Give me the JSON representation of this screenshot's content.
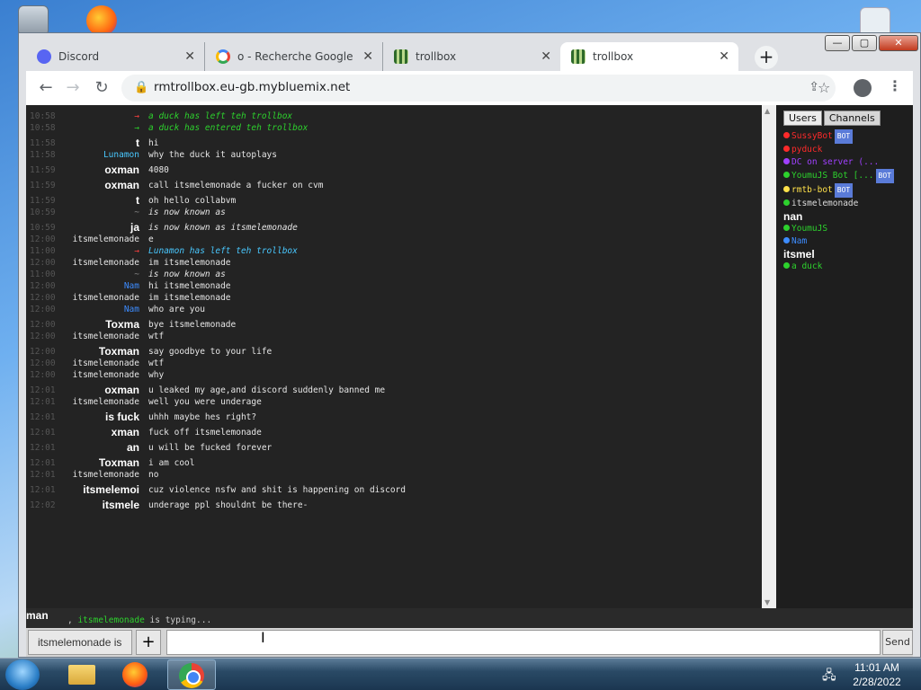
{
  "browser": {
    "tabs": [
      {
        "label": "Discord",
        "icon": "discord-icon"
      },
      {
        "label": "o - Recherche Google",
        "icon": "google-icon"
      },
      {
        "label": "trollbox",
        "icon": "trollbox-icon"
      },
      {
        "label": "trollbox",
        "icon": "trollbox-icon",
        "active": true
      }
    ],
    "new_tab": "+",
    "url": "rmtrollbox.eu-gb.mybluemix.net",
    "win_min": "—",
    "win_max": "▢",
    "win_close": "✕"
  },
  "chat": {
    "messages": [
      {
        "time": "10:58",
        "name": "→",
        "text": "a duck has left teh trollbox",
        "sys": true,
        "color": "#ff4040",
        "tcolor": "#2dd12d"
      },
      {
        "time": "10:58",
        "name": "→",
        "text": "a duck has entered teh trollbox",
        "sys": true,
        "color": "#2dd12d",
        "tcolor": "#2dd12d"
      },
      {
        "time": "11:58",
        "name": "t",
        "text": "hi",
        "big": true
      },
      {
        "time": "11:58",
        "name": "Lunamon",
        "text": "why the duck it autoplays",
        "color": "#49c8ff"
      },
      {
        "time": "11:59",
        "name": "oxman",
        "text": "4080",
        "big": true
      },
      {
        "time": "11:59",
        "name": "oxman",
        "text": "call itsmelemonade a fucker on cvm",
        "big": true
      },
      {
        "time": "11:59",
        "name": "t",
        "text": "oh hello collabvm",
        "big": true
      },
      {
        "time": "10:59",
        "name": "~",
        "text": "is now known as",
        "sys": true,
        "color": "#888"
      },
      {
        "time": "10:59",
        "name": "ja",
        "text": "is now known as itsmelemonade",
        "sys": true,
        "color": "#fff",
        "big": true
      },
      {
        "time": "12:00",
        "name": "itsmelemonade",
        "text": "e"
      },
      {
        "time": "11:00",
        "name": "→",
        "text": "Lunamon has left teh trollbox",
        "sys": true,
        "color": "#ff4040",
        "tcolor": "#49c8ff"
      },
      {
        "time": "12:00",
        "name": "itsmelemonade",
        "text": "im itsmelemonade"
      },
      {
        "time": "11:00",
        "name": "~",
        "text": "is now known as",
        "sys": true,
        "color": "#888"
      },
      {
        "time": "12:00",
        "name": "Nam",
        "text": "hi itsmelemonade",
        "color": "#3d8cff"
      },
      {
        "time": "12:00",
        "name": "itsmelemonade",
        "text": "im itsmelemonade"
      },
      {
        "time": "12:00",
        "name": "Nam",
        "text": "who are you",
        "color": "#3d8cff"
      },
      {
        "time": "12:00",
        "name": "Toxma",
        "text": "bye itsmelemonade",
        "big": true
      },
      {
        "time": "12:00",
        "name": "itsmelemonade",
        "text": "wtf"
      },
      {
        "time": "12:00",
        "name": "Toxman",
        "text": "say goodbye to your life",
        "big": true
      },
      {
        "time": "12:00",
        "name": "itsmelemonade",
        "text": "wtf"
      },
      {
        "time": "12:00",
        "name": "itsmelemonade",
        "text": "why"
      },
      {
        "time": "12:01",
        "name": "oxman",
        "text": "u leaked my age,and discord suddenly banned me",
        "big": true
      },
      {
        "time": "12:01",
        "name": "itsmelemonade",
        "text": "well you were underage"
      },
      {
        "time": "12:01",
        "name": "is fuck",
        "text": "uhhh maybe hes right?",
        "big": true
      },
      {
        "time": "12:01",
        "name": "xman",
        "text": "fuck off itsmelemonade",
        "big": true
      },
      {
        "time": "12:01",
        "name": "an",
        "text": "u will be fucked forever",
        "big": true
      },
      {
        "time": "12:01",
        "name": "Toxman",
        "text": "i am cool",
        "big": true
      },
      {
        "time": "12:01",
        "name": "itsmelemonade",
        "text": "no"
      },
      {
        "time": "12:01",
        "name": "itsmelemoi",
        "text": "cuz violence nsfw and shit is happening on discord",
        "big": true
      },
      {
        "time": "12:02",
        "name": "itsmele",
        "text": "underage ppl shouldnt be there-",
        "big": true
      }
    ]
  },
  "sidebar": {
    "tab_users": "Users",
    "tab_channels": "Channels",
    "users": [
      {
        "name": "SussyBot",
        "color": "#ff2a2a",
        "bot": "BOT"
      },
      {
        "name": "pyduck",
        "color": "#ff2a2a"
      },
      {
        "name": "DC on server (...",
        "color": "#a040ff"
      },
      {
        "name": "YoumuJS Bot [...",
        "color": "#2dd12d",
        "bot": "BOT"
      },
      {
        "name": "rmtb-bot",
        "color": "#ffe14a",
        "bot": "BOT"
      },
      {
        "name": "itsmelemonade",
        "color": "#ddd"
      },
      {
        "name": "nan",
        "color": "#fff",
        "big": true
      },
      {
        "name": "YoumuJS",
        "color": "#2dd12d"
      },
      {
        "name": "Nam",
        "color": "#3d8cff"
      },
      {
        "name": "itsmel",
        "color": "#fff",
        "big": true
      },
      {
        "name": "a duck",
        "color": "#2dd12d"
      }
    ]
  },
  "typing": {
    "name": "man",
    "user": "itsmelemonade",
    "text": "is typing..."
  },
  "input": {
    "name_value": "itsmelemonade is",
    "plus": "+",
    "send": "Send"
  },
  "taskbar": {
    "time": "11:01 AM",
    "date": "2/28/2022"
  }
}
